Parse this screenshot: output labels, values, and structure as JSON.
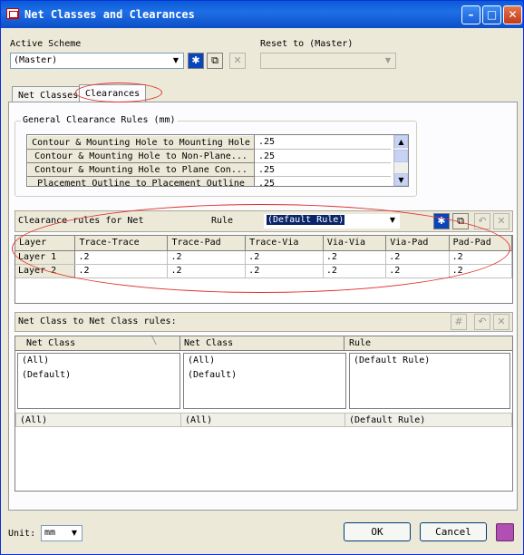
{
  "window": {
    "title": "Net Classes and Clearances",
    "minimize": "–",
    "maximize": "□",
    "close": "✕"
  },
  "scheme": {
    "label": "Active Scheme",
    "value": "(Master)",
    "reset_label": "Reset to (Master)",
    "reset_value": ""
  },
  "tabs": [
    "Net Classes",
    "Clearances"
  ],
  "general_rules": {
    "title": "General Clearance Rules (mm)",
    "rows": [
      {
        "name": "Contour & Mounting Hole to Mounting Hole",
        "value": ".25"
      },
      {
        "name": "Contour & Mounting Hole to Non-Plane...",
        "value": ".25"
      },
      {
        "name": "Contour & Mounting Hole to Plane Con...",
        "value": ".25"
      },
      {
        "name": "Placement Outline to Placement Outline",
        "value": ".25"
      }
    ]
  },
  "net_rules": {
    "label": "Clearance rules for Net",
    "rule_label": "Rule",
    "rule_value": "(Default Rule)",
    "columns": [
      "Layer",
      "Trace-Trace",
      "Trace-Pad",
      "Trace-Via",
      "Via-Via",
      "Via-Pad",
      "Pad-Pad"
    ],
    "rows": [
      [
        "Layer 1",
        ".2",
        ".2",
        ".2",
        ".2",
        ".2",
        ".2"
      ],
      [
        "Layer 2",
        ".2",
        ".2",
        ".2",
        ".2",
        ".2",
        ".2"
      ]
    ]
  },
  "class_rules": {
    "label": "Net Class to Net Class rules:",
    "columns": [
      "Net Class",
      "Net Class",
      "Rule"
    ],
    "col1": [
      "(All)",
      "(Default)"
    ],
    "col2": [
      "(All)",
      "(Default)"
    ],
    "col3": [
      "(Default Rule)"
    ],
    "selected": [
      "(All)",
      "(All)",
      "(Default Rule)"
    ]
  },
  "footer": {
    "unit_label": "Unit:",
    "unit_value": "mm",
    "ok": "OK",
    "cancel": "Cancel"
  },
  "colors": {
    "title_bar": "#0a5ad8",
    "highlight": "#0a246a",
    "annotation": "#e0302e"
  }
}
